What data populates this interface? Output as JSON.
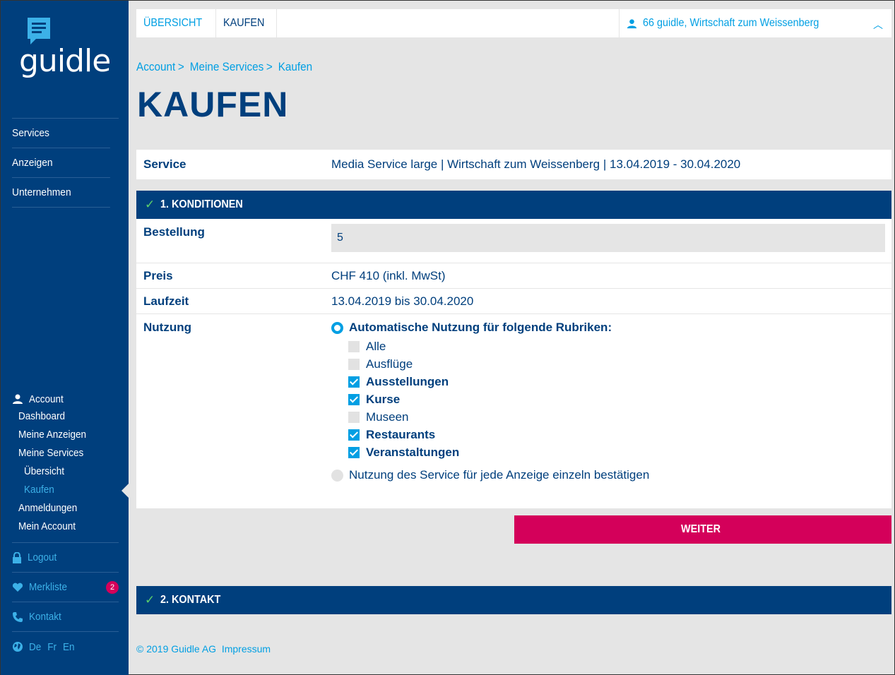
{
  "brand": {
    "logo_text": "guidle"
  },
  "colors": {
    "navy": "#003f7d",
    "cyan": "#009fe3",
    "magenta": "#d4005a"
  },
  "sidebar": {
    "nav": [
      {
        "label": "Services"
      },
      {
        "label": "Anzeigen"
      },
      {
        "label": "Unternehmen"
      }
    ],
    "account": {
      "label": "Account",
      "items": [
        {
          "label": "Dashboard"
        },
        {
          "label": "Meine Anzeigen"
        },
        {
          "label": "Meine Services"
        },
        {
          "label": "Übersicht"
        },
        {
          "label": "Kaufen"
        },
        {
          "label": "Anmeldungen"
        },
        {
          "label": "Mein Account"
        }
      ]
    },
    "logout": "Logout",
    "merkliste": "Merkliste",
    "merkliste_count": "2",
    "kontakt": "Kontakt",
    "languages": [
      "De",
      "Fr",
      "En"
    ]
  },
  "topbar": {
    "tabs": [
      {
        "label": "ÜBERSICHT"
      },
      {
        "label": "KAUFEN"
      }
    ],
    "user": "66 guidle, Wirtschaft zum Weissenberg"
  },
  "breadcrumb": [
    "Account",
    "Meine Services",
    "Kaufen"
  ],
  "page_title": "KAUFEN",
  "service": {
    "label": "Service",
    "value": "Media Service large | Wirtschaft zum Weissenberg | 13.04.2019 - 30.04.2020"
  },
  "section1": {
    "title": "1. KONDITIONEN",
    "bestellung_label": "Bestellung",
    "bestellung_value": "5",
    "preis_label": "Preis",
    "preis_value": "CHF 410 (inkl. MwSt)",
    "laufzeit_label": "Laufzeit",
    "laufzeit_value": "13.04.2019 bis 30.04.2020",
    "nutzung_label": "Nutzung",
    "option_auto": "Automatische Nutzung für folgende Rubriken:",
    "categories": [
      {
        "label": "Alle",
        "checked": false
      },
      {
        "label": "Ausflüge",
        "checked": false
      },
      {
        "label": "Ausstellungen",
        "checked": true
      },
      {
        "label": "Kurse",
        "checked": true
      },
      {
        "label": "Museen",
        "checked": false
      },
      {
        "label": "Restaurants",
        "checked": true
      },
      {
        "label": "Veranstaltungen",
        "checked": true
      }
    ],
    "option_manual": "Nutzung des Service für jede Anzeige einzeln bestätigen"
  },
  "weiter_label": "WEITER",
  "section2": {
    "title": "2. KONTAKT"
  },
  "footer": {
    "copyright": "© 2019 Guidle AG",
    "impressum": "Impressum"
  }
}
